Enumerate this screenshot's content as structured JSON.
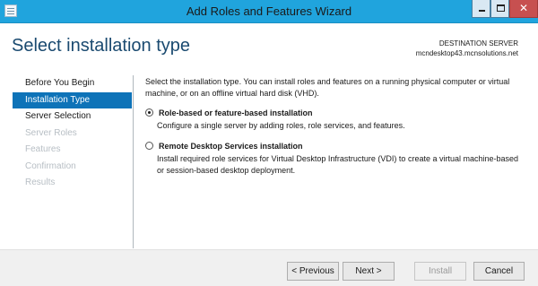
{
  "window": {
    "title": "Add Roles and Features Wizard",
    "controls": {
      "minimize": "_",
      "maximize": "",
      "close": "✕"
    }
  },
  "header": {
    "page_title": "Select installation type",
    "destination_label": "DESTINATION SERVER",
    "destination_server": "mcndesktop43.mcnsolutions.net"
  },
  "nav": {
    "items": [
      {
        "label": "Before You Begin",
        "state": "normal"
      },
      {
        "label": "Installation Type",
        "state": "active"
      },
      {
        "label": "Server Selection",
        "state": "normal"
      },
      {
        "label": "Server Roles",
        "state": "disabled"
      },
      {
        "label": "Features",
        "state": "disabled"
      },
      {
        "label": "Confirmation",
        "state": "disabled"
      },
      {
        "label": "Results",
        "state": "disabled"
      }
    ]
  },
  "main": {
    "description": "Select the installation type. You can install roles and features on a running physical computer or virtual machine, or on an offline virtual hard disk (VHD).",
    "options": [
      {
        "label": "Role-based or feature-based installation",
        "description": "Configure a single server by adding roles, role services, and features.",
        "selected": true
      },
      {
        "label": "Remote Desktop Services installation",
        "description": "Install required role services for Virtual Desktop Infrastructure (VDI) to create a virtual machine-based or session-based desktop deployment.",
        "selected": false
      }
    ]
  },
  "footer": {
    "previous_label": "< Previous",
    "next_label": "Next >",
    "install_label": "Install",
    "cancel_label": "Cancel"
  },
  "colors": {
    "titlebar": "#20a4dd",
    "nav_active": "#0e73b8",
    "page_title": "#1a4a70",
    "close_button": "#c75050"
  }
}
